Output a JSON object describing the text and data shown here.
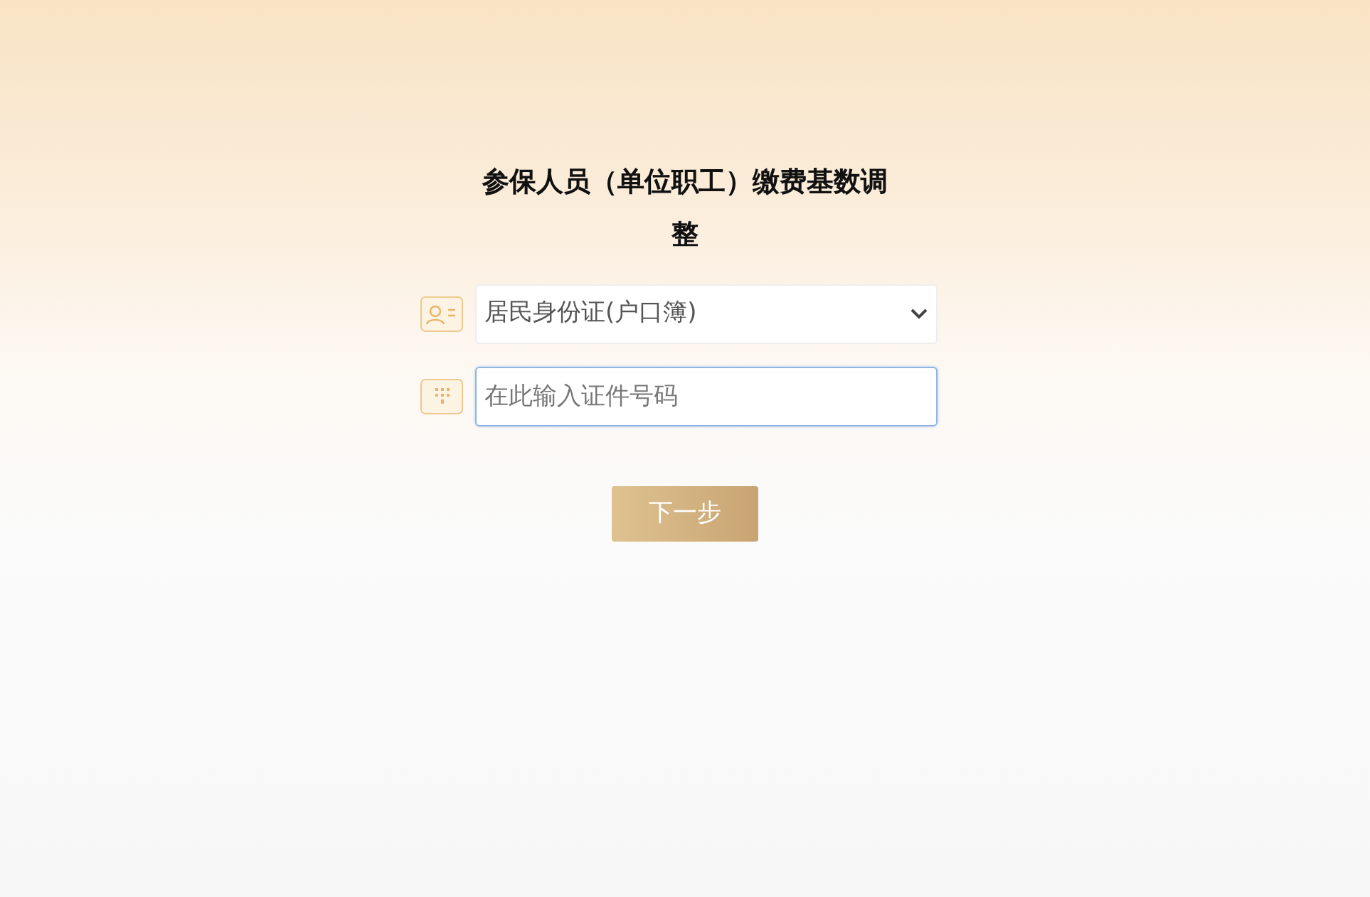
{
  "title": "参保人员（单位职工）缴费基数调整",
  "id_type": {
    "value": "居民身份证(户口簿)"
  },
  "id_number": {
    "placeholder": "在此输入证件号码",
    "focused": true
  },
  "next_button": {
    "label": "下一步"
  }
}
